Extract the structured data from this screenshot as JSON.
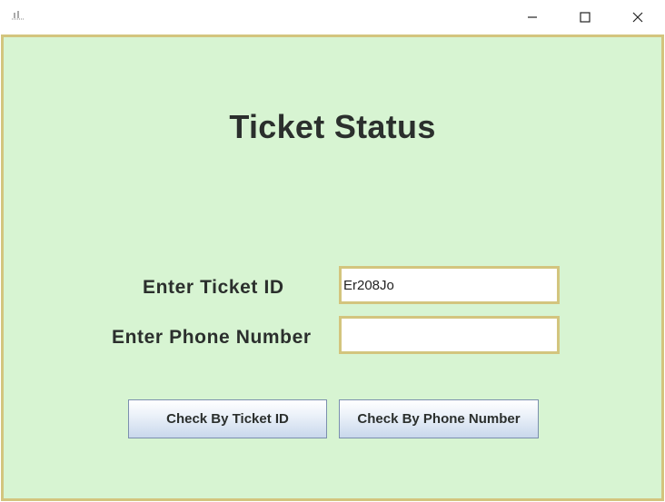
{
  "window": {
    "title": "",
    "controls": [
      "minimize-icon",
      "maximize-icon",
      "close-icon"
    ]
  },
  "form": {
    "heading": "Ticket Status",
    "ticket_id_label": "Enter Ticket ID",
    "ticket_id_value": "Er208Jo",
    "phone_label": "Enter Phone Number",
    "phone_value": ""
  },
  "buttons": {
    "check_ticket_id": "Check By Ticket ID",
    "check_phone": "Check By Phone Number"
  },
  "colors": {
    "background": "#d7f4d2",
    "field_border": "#d3c57e",
    "text": "#2b2f2d"
  }
}
